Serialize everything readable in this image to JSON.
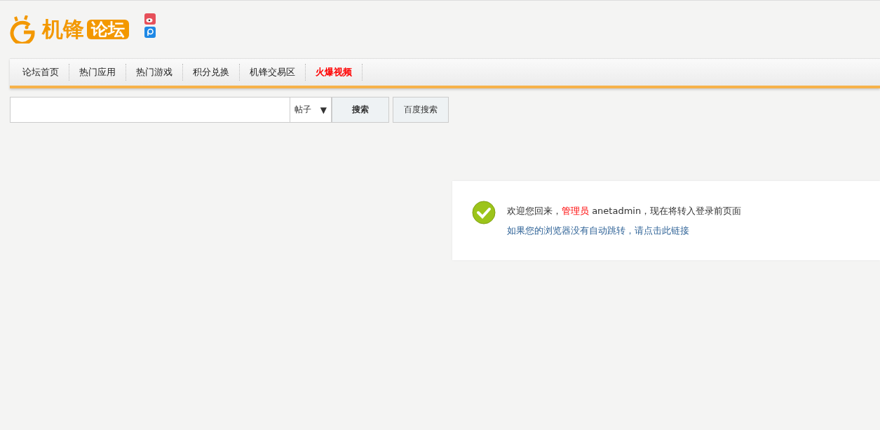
{
  "logo": {
    "main": "机锋",
    "badge": "论坛"
  },
  "nav": [
    {
      "label": "论坛首页",
      "highlight": false
    },
    {
      "label": "热门应用",
      "highlight": false
    },
    {
      "label": "热门游戏",
      "highlight": false
    },
    {
      "label": "积分兑换",
      "highlight": false
    },
    {
      "label": "机锋交易区",
      "highlight": false
    },
    {
      "label": "火爆视频",
      "highlight": true
    }
  ],
  "search": {
    "scope": "帖子",
    "caret": "▼",
    "buttons": [
      "搜索",
      "百度搜索"
    ]
  },
  "message": {
    "segments": [
      {
        "text": "欢迎您回来，",
        "kind": "plain"
      },
      {
        "text": "管理员",
        "kind": "role"
      },
      {
        "text": " anetadmin，现在将转入登录前页面",
        "kind": "plain"
      }
    ],
    "link": "如果您的浏览器没有自动跳转，请点击此链接"
  }
}
